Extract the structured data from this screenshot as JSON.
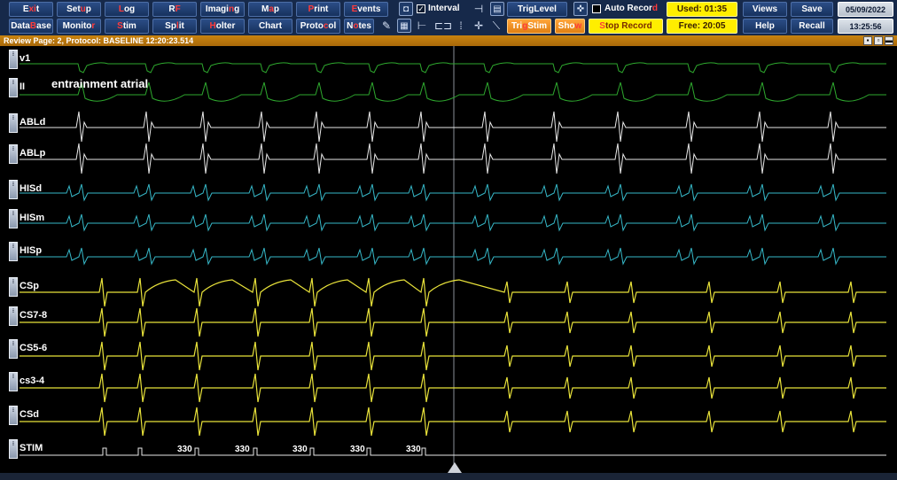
{
  "toolbar": {
    "row1": [
      {
        "name": "exit-button",
        "label_pre": "E",
        "label_hl": "xi",
        "label_post": "t"
      },
      {
        "name": "setup-button",
        "label_pre": "Set",
        "label_hl": "u",
        "label_post": "p"
      },
      {
        "name": "log-button",
        "label_pre": "",
        "label_hl": "L",
        "label_post": "og"
      },
      {
        "name": "rf-button",
        "label_pre": "R",
        "label_hl": "F",
        "label_post": ""
      },
      {
        "name": "imaging-button",
        "label_pre": "Imagi",
        "label_hl": "n",
        "label_post": "g"
      },
      {
        "name": "map-button",
        "label_pre": "M",
        "label_hl": "a",
        "label_post": "p"
      },
      {
        "name": "print-button",
        "label_pre": "",
        "label_hl": "P",
        "label_post": "rint"
      },
      {
        "name": "events-button",
        "label_pre": "",
        "label_hl": "E",
        "label_post": "vents"
      }
    ],
    "row2": [
      {
        "name": "database-button",
        "label_pre": "Data",
        "label_hl": "B",
        "label_post": "ase"
      },
      {
        "name": "monitor-button",
        "label_pre": "Monito",
        "label_hl": "r",
        "label_post": ""
      },
      {
        "name": "stim-button",
        "label_pre": "",
        "label_hl": "S",
        "label_post": "tim"
      },
      {
        "name": "split-button",
        "label_pre": "Sp",
        "label_hl": "l",
        "label_post": "it"
      },
      {
        "name": "holter-button",
        "label_pre": "",
        "label_hl": "H",
        "label_post": "olter"
      },
      {
        "name": "chart-button",
        "label_pre": "Chart",
        "label_hl": "",
        "label_post": ""
      },
      {
        "name": "protocol-button",
        "label_pre": "Proto",
        "label_hl": "c",
        "label_post": "ol"
      },
      {
        "name": "notes-button",
        "label_pre": "N",
        "label_hl": "o",
        "label_post": "tes"
      }
    ],
    "interval_label": "Interval",
    "interval_checked": "✓",
    "trig_level_label": "TrigLevel",
    "auto_record_pre": "Auto Recor",
    "auto_record_hl": "d",
    "tri_stim_pre": "Tri",
    "tri_stim_hl": "g",
    "tri_stim_post": "Stim",
    "show_pre": "Sho",
    "show_hl": "w",
    "stop_record_pre": "",
    "stop_record_hl": "S",
    "stop_record_post": "top Record",
    "used_label": "Used: 01:35",
    "free_label": "Free: 20:05",
    "views_label": "Views",
    "save_label": "Save",
    "help_label": "Help",
    "recall_label": "Recall",
    "date": "05/09/2022",
    "time": "13:25:56"
  },
  "status_bar": {
    "text": "Review Page: 2, Protocol: BASELINE  12:20:23.514",
    "controls": [
      "▪",
      "▫",
      "▬"
    ]
  },
  "annotation": "entrainment atrial",
  "channels": [
    {
      "label": "v1",
      "color": "#2ea82e",
      "kind": "ecg"
    },
    {
      "label": "II",
      "color": "#2ea82e",
      "kind": "ecg2"
    },
    {
      "label": "ABLd",
      "color": "#e8e8e8",
      "kind": "abl"
    },
    {
      "label": "ABLp",
      "color": "#e8e8e8",
      "kind": "abl"
    },
    {
      "label": "HISd",
      "color": "#36b8c8",
      "kind": "his"
    },
    {
      "label": "HISm",
      "color": "#36b8c8",
      "kind": "his"
    },
    {
      "label": "HISp",
      "color": "#36b8c8",
      "kind": "his"
    },
    {
      "label": "CSp",
      "color": "#e8e23a",
      "kind": "cs"
    },
    {
      "label": "CS7-8",
      "color": "#e8e23a",
      "kind": "cs"
    },
    {
      "label": "CS5-6",
      "color": "#e8e23a",
      "kind": "cs"
    },
    {
      "label": "cs3-4",
      "color": "#e8e23a",
      "kind": "cs"
    },
    {
      "label": "CSd",
      "color": "#e8e23a",
      "kind": "cs"
    },
    {
      "label": "STIM",
      "color": "#e8e8e8",
      "kind": "stim"
    }
  ],
  "stim_intervals": [
    "330",
    "330",
    "330",
    "330",
    "330"
  ],
  "colors": {
    "toolbar_bg": "#16294a",
    "status_bar": "#c9830f",
    "highlight_text": "#ff3b3b",
    "ecg": "#2ea82e",
    "abl": "#e8e8e8",
    "his": "#36b8c8",
    "cs": "#e8e23a"
  }
}
